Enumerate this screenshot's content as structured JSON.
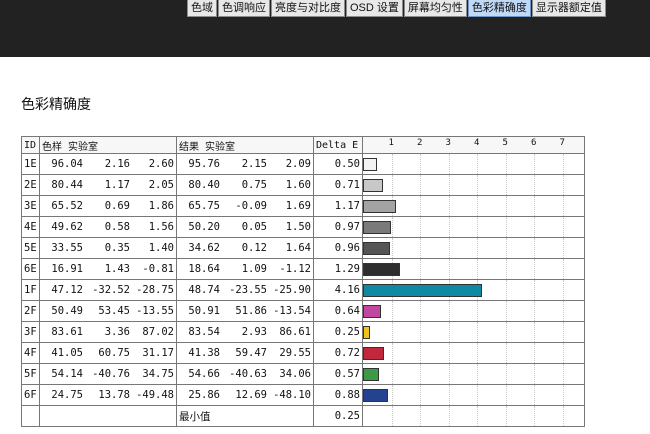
{
  "tabs": [
    {
      "label": "色域",
      "active": false
    },
    {
      "label": "色调响应",
      "active": false
    },
    {
      "label": "亮度与对比度",
      "active": false
    },
    {
      "label": "OSD 设置",
      "active": false
    },
    {
      "label": "屏幕均匀性",
      "active": false
    },
    {
      "label": "色彩精确度",
      "active": true
    },
    {
      "label": "显示器额定值",
      "active": false
    }
  ],
  "page_title": "色彩精确度",
  "table": {
    "headers": {
      "id": "ID",
      "sample": "色样 实验室",
      "result": "结果 实验室",
      "delta": "Delta E"
    },
    "scale_ticks": [
      "1",
      "2",
      "3",
      "4",
      "5",
      "6",
      "7"
    ],
    "rows": [
      {
        "id": "1E",
        "s": [
          "96.04",
          "2.16",
          "2.60"
        ],
        "r": [
          "95.76",
          "2.15",
          "2.09"
        ],
        "delta": "0.50",
        "color": "#f3f3f3"
      },
      {
        "id": "2E",
        "s": [
          "80.44",
          "1.17",
          "2.05"
        ],
        "r": [
          "80.40",
          "0.75",
          "1.60"
        ],
        "delta": "0.71",
        "color": "#c8c8c8"
      },
      {
        "id": "3E",
        "s": [
          "65.52",
          "0.69",
          "1.86"
        ],
        "r": [
          "65.75",
          "-0.09",
          "1.69"
        ],
        "delta": "1.17",
        "color": "#a3a3a3"
      },
      {
        "id": "4E",
        "s": [
          "49.62",
          "0.58",
          "1.56"
        ],
        "r": [
          "50.20",
          "0.05",
          "1.50"
        ],
        "delta": "0.97",
        "color": "#7a7a7a"
      },
      {
        "id": "5E",
        "s": [
          "33.55",
          "0.35",
          "1.40"
        ],
        "r": [
          "34.62",
          "0.12",
          "1.64"
        ],
        "delta": "0.96",
        "color": "#555555"
      },
      {
        "id": "6E",
        "s": [
          "16.91",
          "1.43",
          "-0.81"
        ],
        "r": [
          "18.64",
          "1.09",
          "-1.12"
        ],
        "delta": "1.29",
        "color": "#2e2e2e"
      },
      {
        "id": "1F",
        "s": [
          "47.12",
          "-32.52",
          "-28.75"
        ],
        "r": [
          "48.74",
          "-23.55",
          "-25.90"
        ],
        "delta": "4.16",
        "color": "#0f8aa5"
      },
      {
        "id": "2F",
        "s": [
          "50.49",
          "53.45",
          "-13.55"
        ],
        "r": [
          "50.91",
          "51.86",
          "-13.54"
        ],
        "delta": "0.64",
        "color": "#c0499f"
      },
      {
        "id": "3F",
        "s": [
          "83.61",
          "3.36",
          "87.02"
        ],
        "r": [
          "83.54",
          "2.93",
          "86.61"
        ],
        "delta": "0.25",
        "color": "#f1c21b"
      },
      {
        "id": "4F",
        "s": [
          "41.05",
          "60.75",
          "31.17"
        ],
        "r": [
          "41.38",
          "59.47",
          "29.55"
        ],
        "delta": "0.72",
        "color": "#c1283c"
      },
      {
        "id": "5F",
        "s": [
          "54.14",
          "-40.76",
          "34.75"
        ],
        "r": [
          "54.66",
          "-40.63",
          "34.06"
        ],
        "delta": "0.57",
        "color": "#3c9a47"
      },
      {
        "id": "6F",
        "s": [
          "24.75",
          "13.78",
          "-49.48"
        ],
        "r": [
          "25.86",
          "12.69",
          "-48.10"
        ],
        "delta": "0.88",
        "color": "#24438f"
      }
    ],
    "summary": {
      "label": "最小值",
      "value": "0.25"
    }
  }
}
